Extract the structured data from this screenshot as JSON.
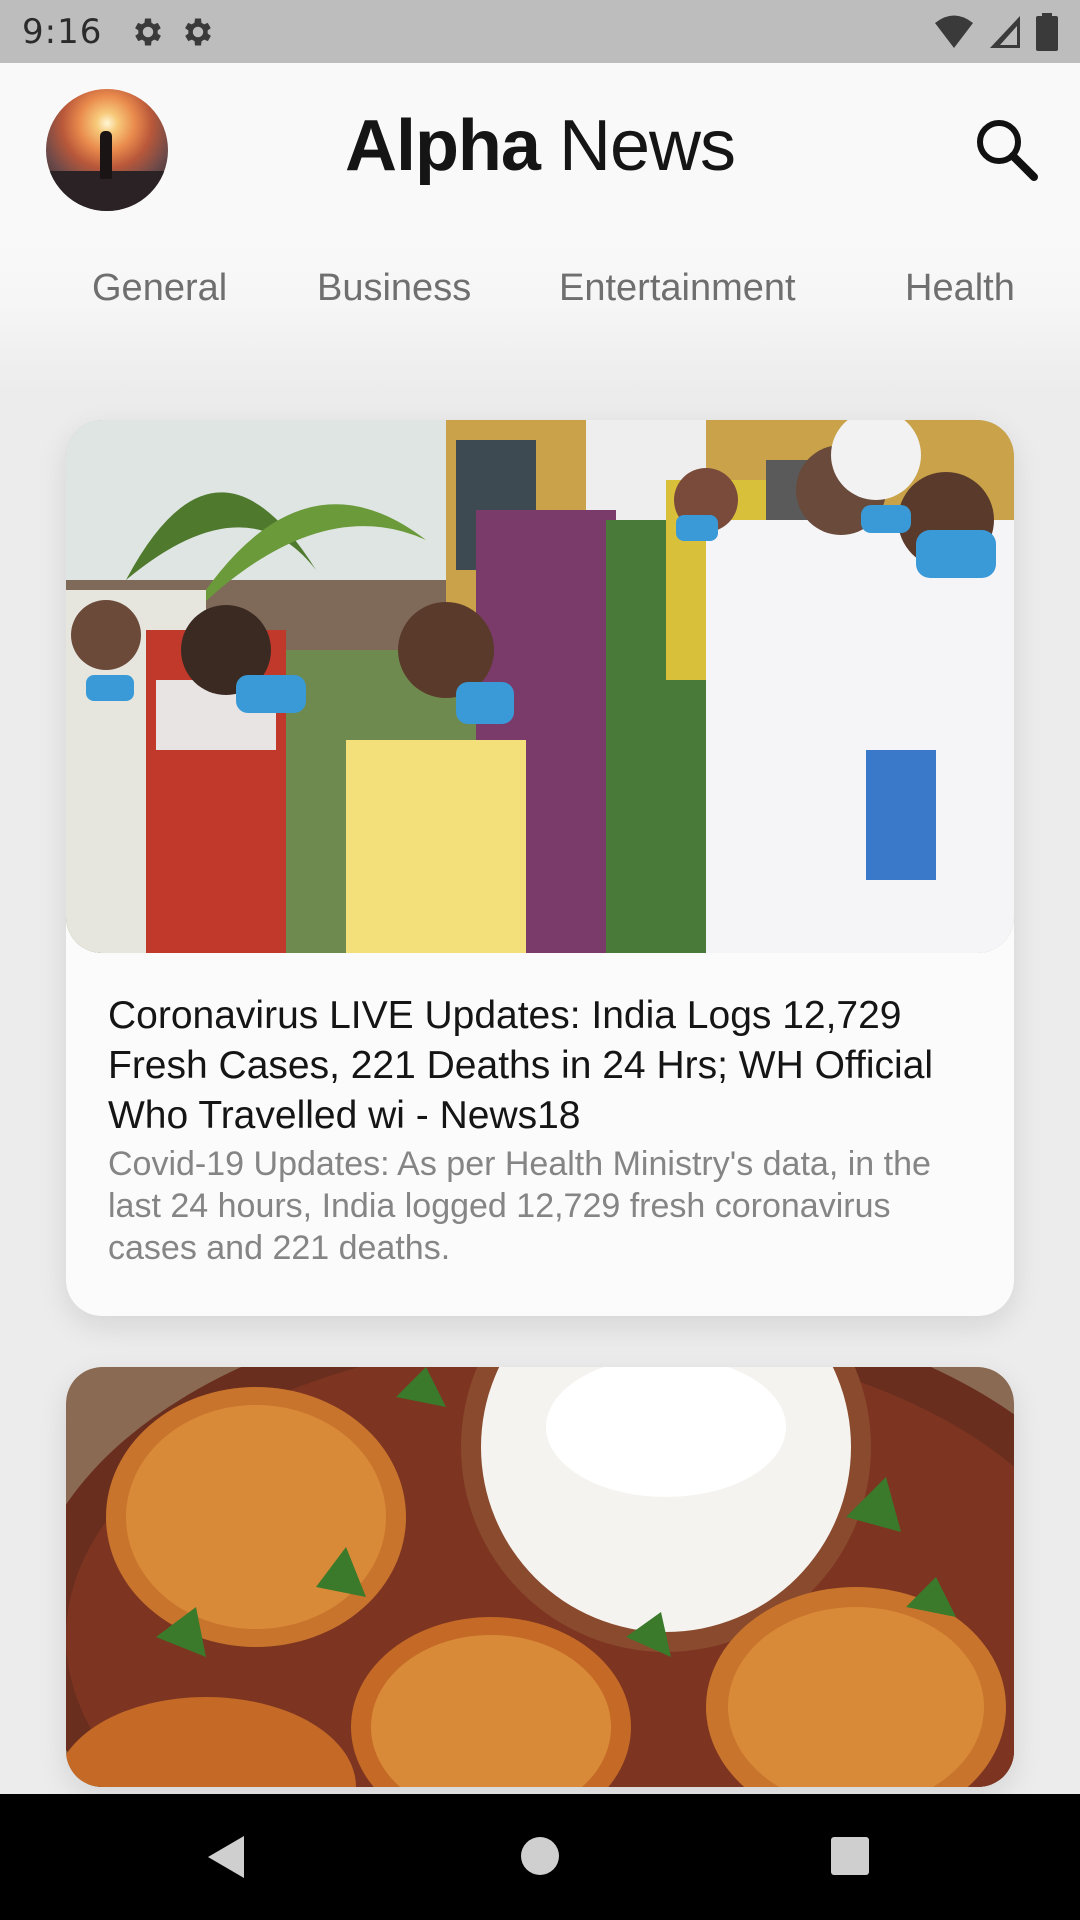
{
  "status_bar": {
    "time": "9:16",
    "left_icons": [
      "gear-icon",
      "gear-icon"
    ],
    "right_icons": [
      "wifi-icon",
      "signal-icon",
      "battery-icon"
    ]
  },
  "header": {
    "title_bold": "Alpha",
    "title_regular": "News",
    "avatar": "avatar-sunset-silhouette",
    "search_icon": "search-icon"
  },
  "tabs": [
    {
      "label": "General"
    },
    {
      "label": "Business"
    },
    {
      "label": "Entertainment"
    },
    {
      "label": "Health"
    }
  ],
  "articles": [
    {
      "headline": "Coronavirus LIVE Updates: India Logs 12,729 Fresh Cases, 221 Deaths in 24 Hrs; WH Official Who Travelled wi - News18",
      "summary": "Covid-19 Updates: As per Health Ministry's data, in the last 24 hours, India logged 12,729 fresh coronavirus cases and 221 deaths."
    },
    {
      "headline": "",
      "summary": ""
    }
  ],
  "nav_bar": {
    "icons": [
      "back-icon",
      "home-icon",
      "recents-icon"
    ]
  },
  "colors": {
    "status_bar": "#bdbdbd",
    "background": "#ececec",
    "card": "#fbfbfb",
    "headline": "#151515",
    "summary": "#858585",
    "tab": "#6f6f6f",
    "nav_bar": "#000000"
  }
}
